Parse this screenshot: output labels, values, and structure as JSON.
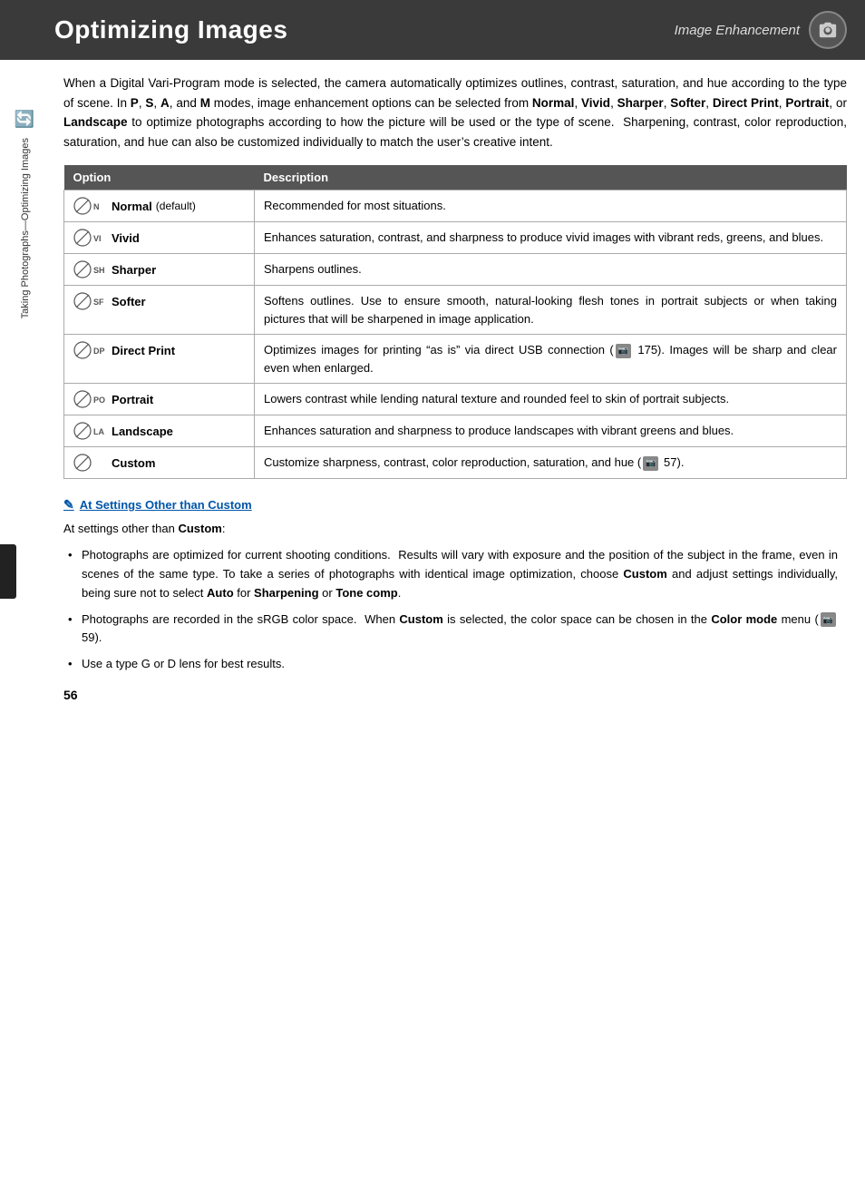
{
  "header": {
    "title": "Optimizing Images",
    "subtitle": "Image Enhancement"
  },
  "intro": {
    "text_parts": [
      "When a Digital Vari-Program mode is selected, the camera automatically optimizes outlines, contrast, saturation, and hue according to the type of scene. In ",
      "P",
      ", ",
      "S",
      ", ",
      "A",
      ", and ",
      "M",
      " modes, image enhancement options can be selected from ",
      "Normal",
      ", ",
      "Vivid",
      ", ",
      "Sharper",
      ", ",
      "Softer",
      ", ",
      "Direct Print",
      ", ",
      "Portrait",
      ", or ",
      "Landscape",
      " to optimize photographs according to how the picture will be used or the type of scene.  Sharpening, contrast, color reproduction, saturation, and hue can also be customized individually to match the user’s creative intent."
    ]
  },
  "table": {
    "col_option": "Option",
    "col_desc": "Description",
    "rows": [
      {
        "icon": "ØN",
        "name": "Normal",
        "sub": "(default)",
        "desc": "Recommended for most situations."
      },
      {
        "icon": "ØVI",
        "name": "Vivid",
        "sub": "",
        "desc": "Enhances saturation, contrast, and sharpness to produce vivid images with vibrant reds, greens, and blues."
      },
      {
        "icon": "ØSH",
        "name": "Sharper",
        "sub": "",
        "desc": "Sharpens outlines."
      },
      {
        "icon": "ØSF",
        "name": "Softer",
        "sub": "",
        "desc": "Softens outlines.  Use to ensure smooth, natural-looking flesh tones in portrait subjects or when taking pictures that will be sharpened in image application."
      },
      {
        "icon": "ØDP",
        "name": "Direct Print",
        "sub": "",
        "desc": "Optimizes images for printing “as is” via direct USB connection (📷 175).  Images will be sharp and clear even when enlarged."
      },
      {
        "icon": "ØPO",
        "name": "Portrait",
        "sub": "",
        "desc": "Lowers contrast while lending natural texture and rounded feel to skin of portrait subjects."
      },
      {
        "icon": "ØLA",
        "name": "Landscape",
        "sub": "",
        "desc": "Enhances saturation and sharpness to produce landscapes with vibrant greens and blues."
      },
      {
        "icon": "ØØ",
        "name": "Custom",
        "sub": "",
        "desc": "Customize sharpness, contrast, color reproduction, saturation, and hue (📷 57)."
      }
    ]
  },
  "notes": {
    "title": "At Settings Other than Custom",
    "intro": "At settings other than Custom:",
    "bullets": [
      "Photographs are optimized for current shooting conditions.  Results will vary with exposure and the position of the subject in the frame, even in scenes of the same type.  To take a series of photographs with identical image optimization, choose Custom and adjust settings individually, being sure not to select Auto for Sharpening or Tone comp.",
      "Photographs are recorded in the sRGB color space.  When Custom is selected, the color space can be chosen in the Color mode menu (📷 59).",
      "Use a type G or D lens for best results."
    ]
  },
  "page_number": "56",
  "side_tab_text": "Taking Photographs—Optimizing Images"
}
